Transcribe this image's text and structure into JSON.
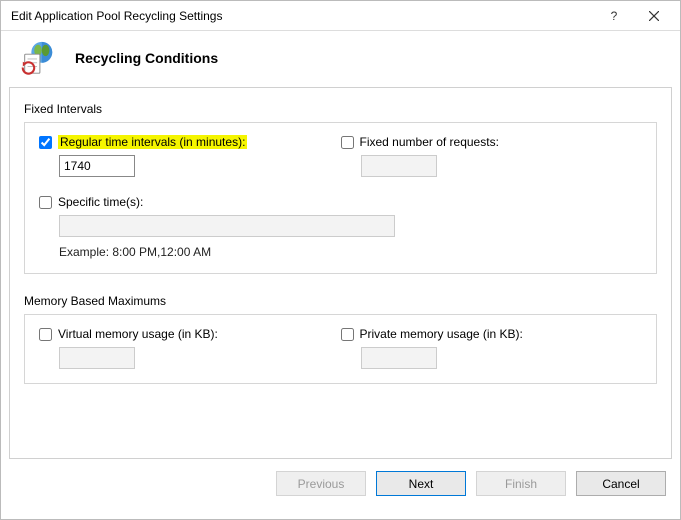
{
  "window": {
    "title": "Edit Application Pool Recycling Settings"
  },
  "header": {
    "title": "Recycling Conditions"
  },
  "fixedIntervals": {
    "legend": "Fixed Intervals",
    "regularTime": {
      "label": "Regular time intervals (in minutes):",
      "checked": true,
      "value": "1740"
    },
    "fixedRequests": {
      "label": "Fixed number of requests:",
      "checked": false,
      "value": ""
    },
    "specificTimes": {
      "label": "Specific time(s):",
      "checked": false,
      "value": "",
      "example": "Example: 8:00 PM,12:00 AM"
    }
  },
  "memoryMaximums": {
    "legend": "Memory Based Maximums",
    "virtual": {
      "label": "Virtual memory usage (in KB):",
      "checked": false,
      "value": ""
    },
    "private": {
      "label": "Private memory usage (in KB):",
      "checked": false,
      "value": ""
    }
  },
  "buttons": {
    "previous": "Previous",
    "next": "Next",
    "finish": "Finish",
    "cancel": "Cancel"
  }
}
